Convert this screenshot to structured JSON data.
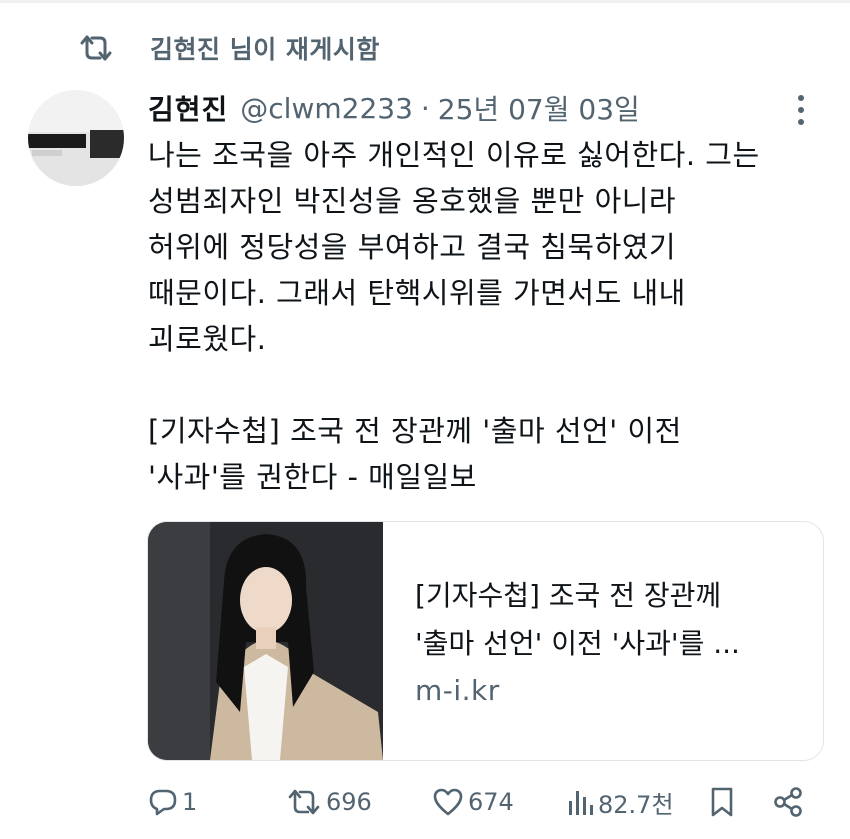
{
  "retweet_header": {
    "icon": "retweet-icon",
    "text": "김현진 님이 재게시함"
  },
  "tweet": {
    "author_name": "김현진",
    "handle": "@clwm2233",
    "separator": "·",
    "date": "25년 07월 03일",
    "lines": [
      "나는 조국을 아주 개인적인 이유로 싫어한다. 그는",
      "성범죄자인 박진성을 옹호했을 뿐만 아니라",
      "허위에 정당성을 부여하고 결국 침묵하였기",
      "때문이다. 그래서 탄핵시위를 가면서도 내내",
      "괴로웠다."
    ],
    "link_lines": [
      "[기자수첩] 조국 전 장관께 '출마 선언' 이전",
      "'사과'를 권한다 - 매일일보"
    ]
  },
  "card": {
    "title_lines": [
      "[기자수첩] 조국 전 장관께",
      "'출마 선언' 이전 '사과'를 ..."
    ],
    "domain": "m-i.kr"
  },
  "actions": {
    "reply_count": "1",
    "repost_count": "696",
    "like_count": "674",
    "view_count": "82.7천"
  },
  "colors": {
    "text": "#0f1419",
    "secondary": "#536471",
    "border": "#e1e5e9"
  }
}
